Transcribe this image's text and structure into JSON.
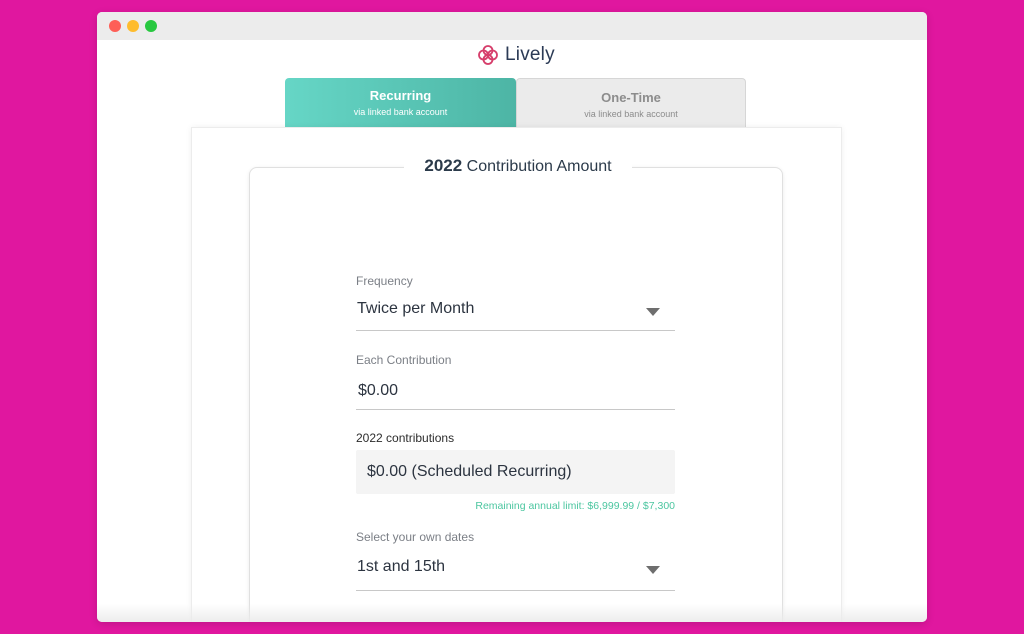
{
  "brand": {
    "name": "Lively",
    "logo_icon": "lively-clover-logo",
    "color": "#d63e6b"
  },
  "tabs": [
    {
      "title": "Recurring",
      "subtitle": "via linked bank account",
      "active": true
    },
    {
      "title": "One-Time",
      "subtitle": "via linked bank account",
      "active": false
    }
  ],
  "card": {
    "year": "2022",
    "title": "Contribution Amount"
  },
  "form": {
    "frequency": {
      "label": "Frequency",
      "value": "Twice per Month",
      "icon": "chevron-down-icon"
    },
    "each_contribution": {
      "label": "Each Contribution",
      "value": "$0.00"
    },
    "contributions_summary": {
      "label": "2022 contributions",
      "value": "$0.00 (Scheduled Recurring)"
    },
    "remaining_limit": "Remaining annual limit: $6,999.99 / $7,300",
    "dates": {
      "label": "Select your own dates",
      "value": "1st and 15th",
      "icon": "chevron-down-icon"
    }
  },
  "colors": {
    "background": "#e0179f",
    "accent": "#4cc6a0",
    "tab_active": "#5bc8b8"
  }
}
